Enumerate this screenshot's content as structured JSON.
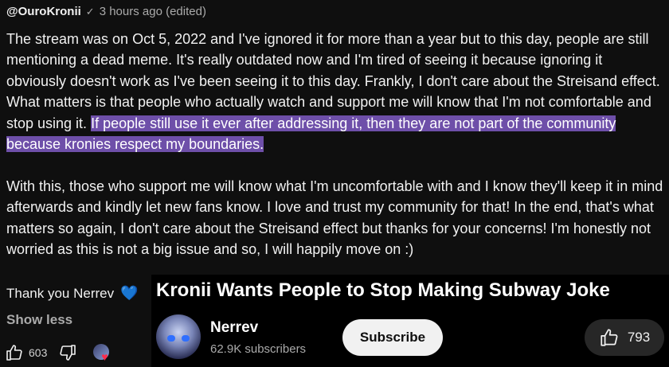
{
  "comment": {
    "handle": "@OuroKronii",
    "verified_icon": "checkmark-icon",
    "timestamp": "3 hours ago (edited)",
    "para1_plain": "The stream was on Oct 5, 2022 and I've ignored it for more than a year but to this day, people are still mentioning a dead meme. It's really outdated now and I'm tired of seeing it because ignoring it obviously doesn't work as I've been seeing it to this day. Frankly, I don't care about the Streisand effect. What matters is that people who actually watch and support me will know that I'm not comfortable and stop using it.",
    "para1_highlight": "If people still use it ever after addressing it, then they are not part of the community because kronies respect my boundaries.",
    "para2": "With this, those who support me will know what I'm uncomfortable with and I know they'll keep it in mind afterwards and kindly let new fans know. I love and trust my community for that! In the end, that's what matters so again, I don't care about the Streisand effect but thanks for your concerns! I'm honestly not worried as this is not a big issue and so, I will happily move on :)",
    "thanks": "Thank you Nerrev",
    "thanks_emoji": "💙",
    "show_less": "Show less",
    "like_count": "603"
  },
  "video": {
    "title": "Kronii Wants People to Stop Making Subway Joke",
    "channel": "Nerrev",
    "subscribers": "62.9K subscribers",
    "subscribe_label": "Subscribe",
    "likes": "793"
  },
  "colors": {
    "background": "#0f0f0f",
    "highlight": "#6e4fa9",
    "secondary_text": "#aaaaaa"
  }
}
